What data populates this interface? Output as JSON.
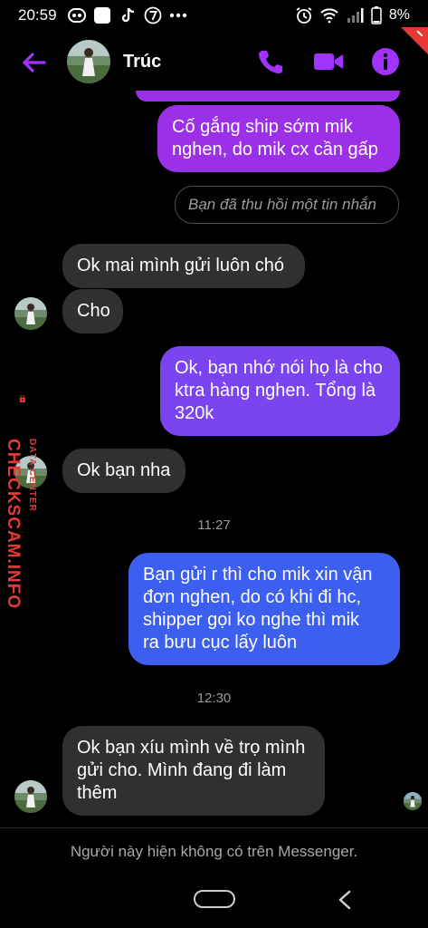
{
  "status_bar": {
    "time": "20:59",
    "battery": "8%",
    "icons": [
      "messenger-icon",
      "app-icon",
      "tiktok-icon",
      "seven-icon",
      "more-dots-icon",
      "alarm-icon",
      "wifi-icon",
      "signal-icon",
      "battery-icon"
    ]
  },
  "header": {
    "contact_name": "Trúc",
    "accent_color": "#a033ff"
  },
  "messages": [
    {
      "side": "out",
      "text_lines": [
        "Cố gắng ship sớm mik",
        "nghen, do mik cx cần gấp"
      ],
      "color": "#9b30e8"
    },
    {
      "type": "recalled",
      "text": "Bạn đã thu hồi một tin nhắn"
    },
    {
      "side": "in",
      "text_lines": [
        "Ok mai mình gửi luôn chó"
      ]
    },
    {
      "side": "in",
      "text_lines": [
        "Cho"
      ]
    },
    {
      "side": "out",
      "text_lines": [
        "Ok, bạn nhớ nói họ là cho",
        "ktra hàng nghen. Tổng là",
        "320k"
      ],
      "color": "#7a44f0"
    },
    {
      "side": "in",
      "text_lines": [
        "Ok bạn nha"
      ]
    },
    {
      "type": "timestamp",
      "text": "11:27"
    },
    {
      "side": "out",
      "text_lines": [
        "Bạn gửi r thì cho mik xin vận",
        "đơn nghen, do có khi đi hc,",
        "shipper gọi ko nghe thì mik",
        "ra bưu cục lấy luôn"
      ],
      "color": "#3d5ff0"
    },
    {
      "type": "timestamp",
      "text": "12:30"
    },
    {
      "side": "in",
      "text_lines": [
        "Ok bạn xíu mình về trọ mình",
        "gửi cho. Mình đang đi làm",
        "thêm"
      ]
    }
  ],
  "footer": {
    "note": "Người này hiện không có trên Messenger."
  },
  "watermark": {
    "main": "CHECKSCAM.INFO",
    "sub": "DATA CENTER"
  }
}
